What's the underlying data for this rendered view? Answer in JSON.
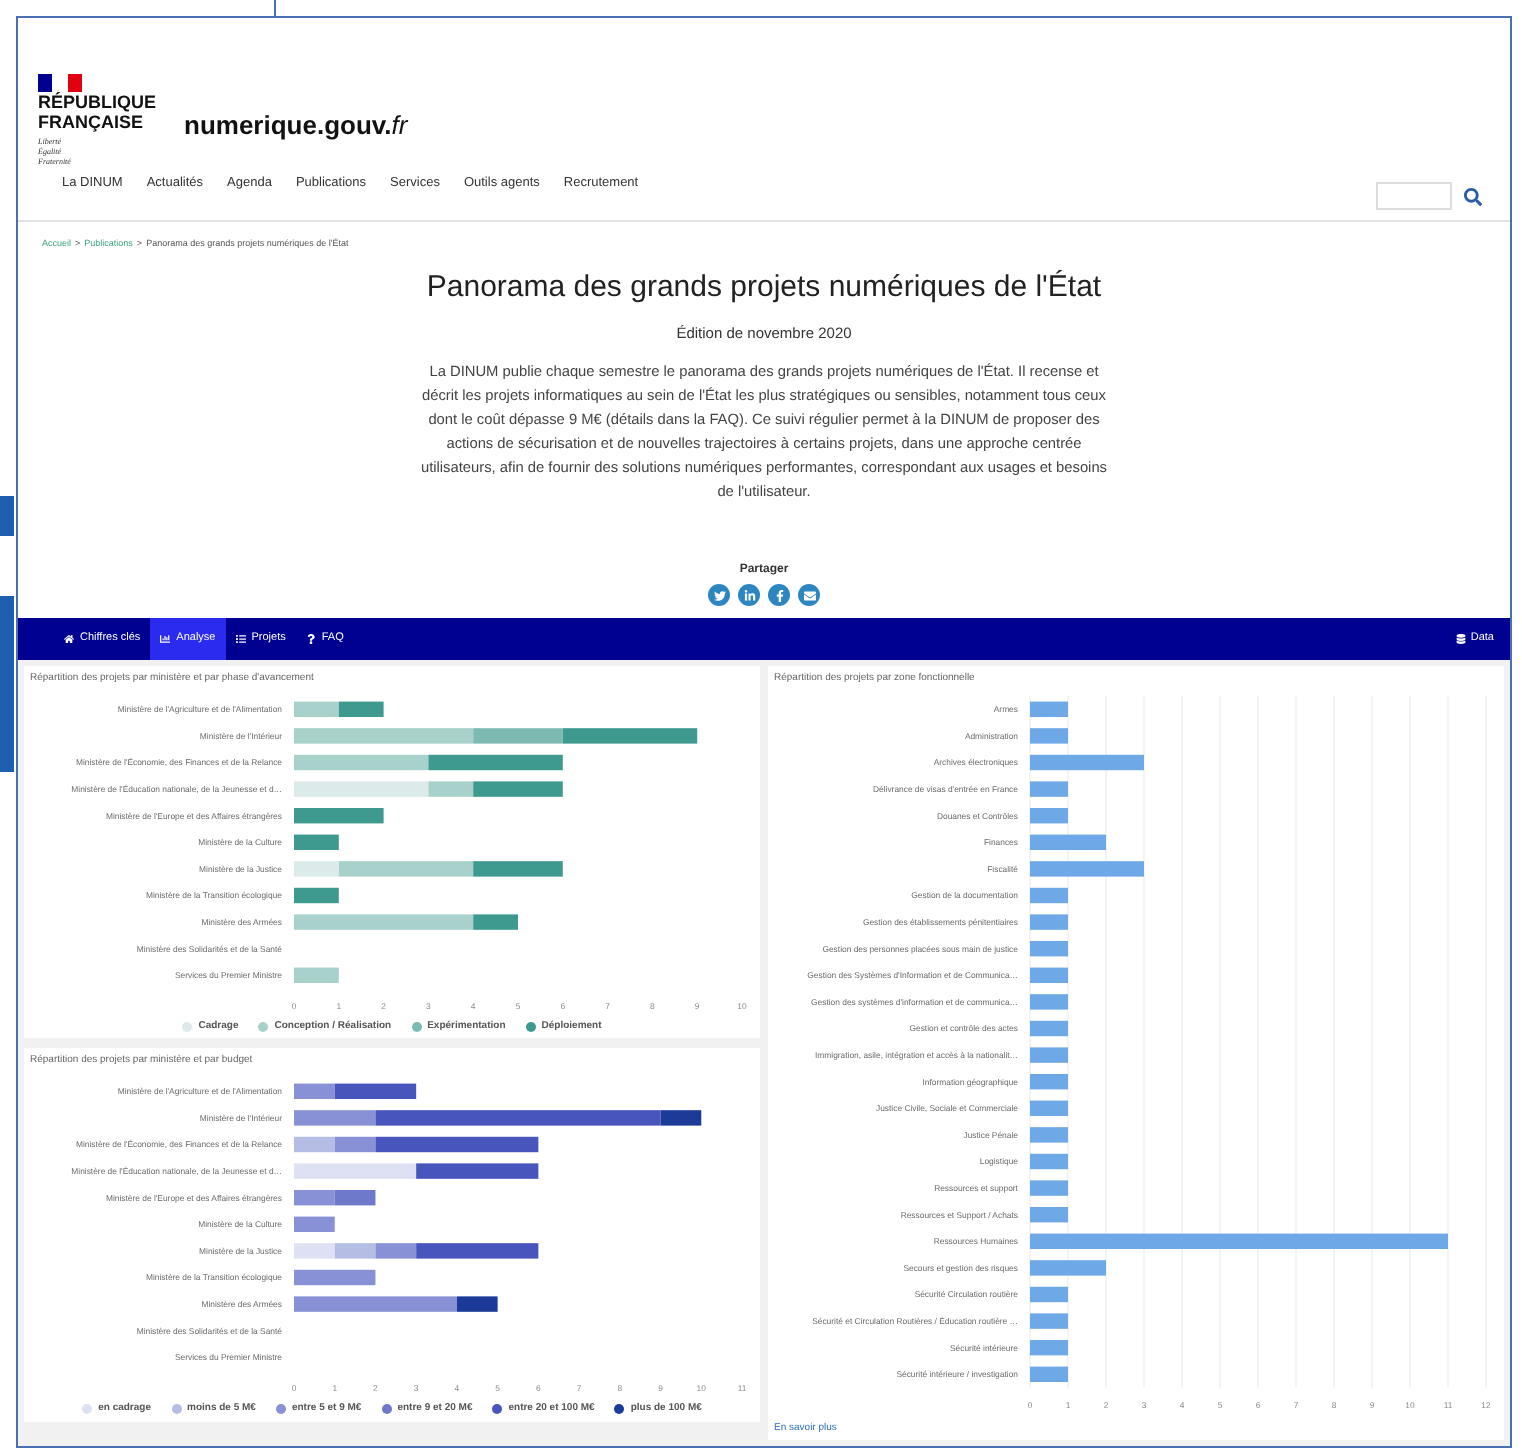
{
  "header": {
    "marianne_lines": [
      "RÉPUBLIQUE",
      "FRANÇAISE"
    ],
    "motto": [
      "Liberté",
      "Égalité",
      "Fraternité"
    ],
    "site_name": "numerique.gouv.",
    "site_suffix": "fr"
  },
  "nav": {
    "items": [
      "La DINUM",
      "Actualités",
      "Agenda",
      "Publications",
      "Services",
      "Outils agents",
      "Recrutement"
    ]
  },
  "breadcrumb": {
    "separator": ">",
    "items": [
      "Accueil",
      "Publications",
      "Panorama des grands projets numériques de l'État"
    ]
  },
  "page": {
    "title": "Panorama des grands projets numériques de l'État",
    "edition": "Édition de novembre 2020",
    "intro": "La DINUM publie chaque semestre le panorama des grands projets numériques de l'État. Il recense et décrit les projets informatiques au sein de l'État les plus stratégiques ou sensibles, notamment tous ceux dont le coût dépasse 9 M€ (détails dans la FAQ). Ce suivi régulier permet à la DINUM de proposer des actions de sécurisation et de nouvelles trajectoires à certains projets, dans une approche centrée utilisateurs, afin de fournir des solutions numériques performantes, correspondant aux usages et besoins de l'utilisateur."
  },
  "share": {
    "label": "Partager",
    "links": [
      {
        "kind": "twitter"
      },
      {
        "kind": "linkedin"
      },
      {
        "kind": "facebook"
      },
      {
        "kind": "mail"
      }
    ]
  },
  "tabs": [
    {
      "label": "Chiffres clés",
      "kind": "home",
      "selected": false
    },
    {
      "label": "Analyse",
      "kind": "chart",
      "selected": true
    },
    {
      "label": "Projets",
      "kind": "list",
      "selected": false
    },
    {
      "label": "FAQ",
      "kind": "faq",
      "selected": false
    }
  ],
  "data_tab": {
    "label": "Data"
  },
  "charts": [
    {
      "title": "Répartition des projets par ministère et par phase d'avancement",
      "chart_data": {
        "type": "bar",
        "orientation": "horizontal",
        "stacked": true,
        "categories": [
          "Ministère de l'Agriculture et de l'Alimentation",
          "Ministère de l'Intérieur",
          "Ministère de l'Économie, des Finances et de la Relance",
          "Ministère de l'Éducation nationale, de la Jeunesse et d…",
          "Ministère de l'Europe et des Affaires étrangères",
          "Ministère de la Culture",
          "Ministère de la Justice",
          "Ministère de la Transition écologique",
          "Ministère des Armées",
          "Ministère des Solidarités et de la Santé",
          "Services du Premier Ministre"
        ],
        "series": [
          {
            "name": "Cadrage",
            "color": "#dcebe9",
            "values": [
              0,
              0,
              0,
              3,
              0,
              0,
              1,
              0,
              0,
              0,
              0
            ]
          },
          {
            "name": "Conception / Réalisation",
            "color": "#a8d1cb",
            "values": [
              1,
              4,
              3,
              1,
              0,
              0,
              3,
              0,
              4,
              0,
              1
            ]
          },
          {
            "name": "Expérimentation",
            "color": "#7dbbb2",
            "values": [
              0,
              2,
              0,
              0,
              0,
              0,
              0,
              0,
              0,
              0,
              0
            ]
          },
          {
            "name": "Déploiement",
            "color": "#3e9a8e",
            "values": [
              1,
              3,
              3,
              2,
              2,
              1,
              2,
              1,
              1,
              0,
              0
            ]
          }
        ],
        "xlim": [
          0,
          10
        ],
        "xticks": [
          0,
          1,
          2,
          3,
          4,
          5,
          6,
          7,
          8,
          9,
          10
        ]
      }
    },
    {
      "title": "Répartition des projets par ministère et par budget",
      "chart_data": {
        "type": "bar",
        "orientation": "horizontal",
        "stacked": true,
        "categories": [
          "Ministère de l'Agriculture et de l'Alimentation",
          "Ministère de l'Intérieur",
          "Ministère de l'Économie, des Finances et de la Relance",
          "Ministère de l'Éducation nationale, de la Jeunesse et d…",
          "Ministère de l'Europe et des Affaires étrangères",
          "Ministère de la Culture",
          "Ministère de la Justice",
          "Ministère de la Transition écologique",
          "Ministère des Armées",
          "Ministère des Solidarités et de la Santé",
          "Services du Premier Ministre"
        ],
        "series": [
          {
            "name": "en cadrage",
            "color": "#dde1f3",
            "values": [
              0,
              0,
              0,
              3,
              0,
              0,
              1,
              0,
              0,
              0,
              0
            ]
          },
          {
            "name": "moins de 5 M€",
            "color": "#b6bde5",
            "values": [
              0,
              0,
              1,
              0,
              0,
              0,
              1,
              0,
              0,
              0,
              0
            ]
          },
          {
            "name": "entre 5 et 9 M€",
            "color": "#8891d6",
            "values": [
              1,
              2,
              1,
              0,
              1,
              1,
              1,
              2,
              4,
              0,
              0
            ]
          },
          {
            "name": "entre 9 et 20 M€",
            "color": "#6e79cc",
            "values": [
              0,
              0,
              0,
              0,
              1,
              0,
              0,
              0,
              0,
              0,
              0
            ]
          },
          {
            "name": "entre 20 et 100 M€",
            "color": "#4755bd",
            "values": [
              2,
              7,
              4,
              3,
              0,
              0,
              3,
              0,
              0,
              0,
              0
            ]
          },
          {
            "name": "plus de 100 M€",
            "color": "#1c3b98",
            "values": [
              0,
              1,
              0,
              0,
              0,
              0,
              0,
              0,
              1,
              0,
              0
            ]
          }
        ],
        "xlim": [
          0,
          11
        ],
        "xticks": [
          0,
          1,
          2,
          3,
          4,
          5,
          6,
          7,
          8,
          9,
          10,
          11
        ]
      }
    },
    {
      "title": "Répartition des projets par zone fonctionnelle",
      "link": "En savoir plus",
      "chart_data": {
        "type": "bar",
        "orientation": "horizontal",
        "stacked": false,
        "categories": [
          "Armes",
          "Administration",
          "Archives électroniques",
          "Délivrance de visas d'entrée en France",
          "Douanes et Contrôles",
          "Finances",
          "Fiscalité",
          "Gestion de la documentation",
          "Gestion des établissements pénitentiaires",
          "Gestion des personnes placées sous main de justice",
          "Gestion des Systèmes d'Information et de Communica…",
          "Gestion des systèmes d'information et de communica…",
          "Gestion et contrôle des actes",
          "Immigration, asile, intégration et accès à la nationalit…",
          "Information géographique",
          "Justice Civile, Sociale et Commerciale",
          "Justice Pénale",
          "Logistique",
          "Ressources et support",
          "Ressources et Support / Achats",
          "Ressources Humaines",
          "Secours et gestion des risques",
          "Sécurité Circulation routière",
          "Sécurité et Circulation Routières / Éducation routière …",
          "Sécurité intérieure",
          "Sécurité intérieure / investigation"
        ],
        "grid": true,
        "series": [
          {
            "color": "#6ea8e6",
            "values": [
              1,
              1,
              3,
              1,
              1,
              2,
              3,
              1,
              1,
              1,
              1,
              1,
              1,
              1,
              1,
              1,
              1,
              1,
              1,
              1,
              11,
              2,
              1,
              1,
              1,
              1
            ]
          }
        ],
        "xlim": [
          0,
          12
        ],
        "xticks": [
          0,
          1,
          2,
          3,
          4,
          5,
          6,
          7,
          8,
          9,
          10,
          11,
          12
        ]
      }
    }
  ]
}
